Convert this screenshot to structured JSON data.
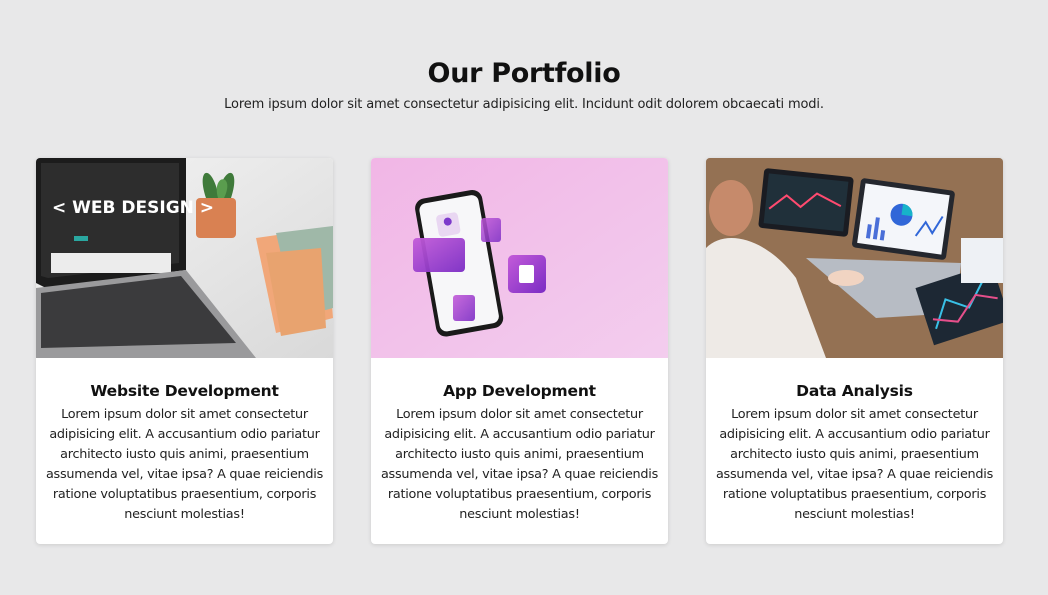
{
  "section": {
    "title": "Our Portfolio",
    "subtitle": "Lorem ipsum dolor sit amet consectetur adipisicing elit. Incidunt odit dolorem obcaecati modi."
  },
  "cards": [
    {
      "title": "Website Development",
      "description": "Lorem ipsum dolor sit amet consectetur adipisicing elit. A accusantium odio pariatur architecto iusto quis animi, praesentium assumenda vel, vitae ipsa? A quae reiciendis ratione voluptatibus praesentium, corporis nesciunt molestias!",
      "image_text": "< WEB DESIGN >"
    },
    {
      "title": "App Development",
      "description": "Lorem ipsum dolor sit amet consectetur adipisicing elit. A accusantium odio pariatur architecto iusto quis animi, praesentium assumenda vel, vitae ipsa? A quae reiciendis ratione voluptatibus praesentium, corporis nesciunt molestias!"
    },
    {
      "title": "Data Analysis",
      "description": "Lorem ipsum dolor sit amet consectetur adipisicing elit. A accusantium odio pariatur architecto iusto quis animi, praesentium assumenda vel, vitae ipsa? A quae reiciendis ratione voluptatibus praesentium, corporis nesciunt molestias!"
    }
  ],
  "colors": {
    "page_background": "#e8e8e9",
    "card_background": "#ffffff",
    "app_image_pink": "#f0c4e8"
  }
}
